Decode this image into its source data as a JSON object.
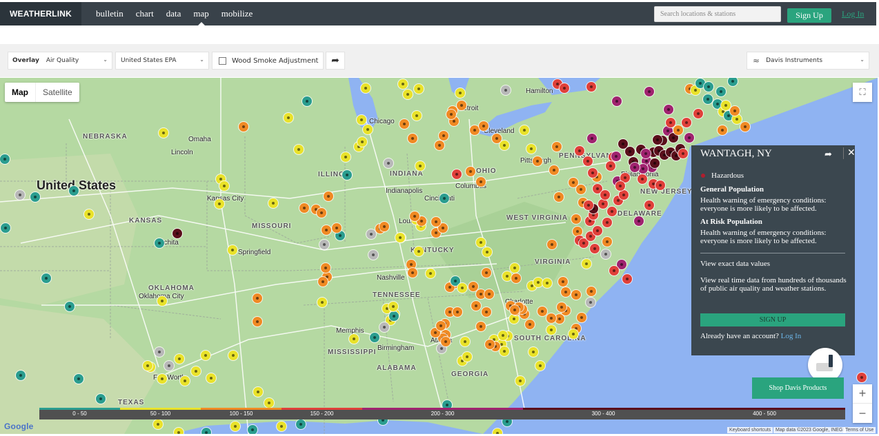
{
  "nav": {
    "brand": "WEATHERLINK",
    "links": [
      "bulletin",
      "chart",
      "data",
      "map",
      "mobilize"
    ],
    "active": "map",
    "search_placeholder": "Search locations & stations",
    "signup": "Sign Up",
    "login": "Log In"
  },
  "toolbar": {
    "overlay_label": "Overlay",
    "overlay_value": "Air Quality",
    "standard_value": "United States EPA",
    "wood_smoke": "Wood Smoke Adjustment",
    "share_icon": "share-icon",
    "network_value": "Davis Instruments"
  },
  "map": {
    "type_buttons": [
      "Map",
      "Satellite"
    ],
    "active_type": "Map",
    "zoom_in": "+",
    "zoom_out": "−",
    "labels": {
      "country": "United States",
      "states": [
        "NEBRASKA",
        "KANSAS",
        "MISSOURI",
        "OKLAHOMA",
        "TEXAS",
        "ILLINOIS",
        "INDIANA",
        "OHIO",
        "KENTUCKY",
        "TENNESSEE",
        "MISSISSIPPI",
        "ALABAMA",
        "GEORGIA",
        "SOUTH CAROLINA",
        "WEST VIRGINIA",
        "VIRGINIA",
        "PENNSYLVANIA",
        "NEW JERSEY",
        "DELAWARE"
      ],
      "cities": [
        "Omaha",
        "Lincoln",
        "Kansas City",
        "Wichita",
        "Springfield",
        "Chicago",
        "Indianapolis",
        "Columbus",
        "Cincinnati",
        "Louisville",
        "Nashville",
        "Oklahoma City",
        "Fort Worth",
        "Atlanta",
        "Charlotte",
        "Pittsburgh",
        "Philadelphia",
        "Detroit",
        "Cleveland",
        "Memphis",
        "Birmingham",
        "Hamilton"
      ]
    },
    "legend": [
      {
        "label": "0 - 50",
        "color": "#2a9d8f"
      },
      {
        "label": "50 - 100",
        "color": "#e9e22a"
      },
      {
        "label": "100 - 150",
        "color": "#f08a24"
      },
      {
        "label": "150 - 200",
        "color": "#e0403a"
      },
      {
        "label": "200 - 300",
        "color": "#a0236f"
      },
      {
        "label": "300 - 400",
        "color": "#5a0f1b"
      },
      {
        "label": "400 - 500",
        "color": "#5a0f1b"
      }
    ],
    "attribution": [
      "Keyboard shortcuts",
      "Map data ©2023 Google, INEGI",
      "Terms of Use"
    ],
    "google": "Google"
  },
  "popup": {
    "title": "WANTAGH, NY",
    "status": "Hazardous",
    "general_heading": "General Population",
    "general_text": "Health warning of emergency conditions: everyone is more likely to be affected.",
    "risk_heading": "At Risk Population",
    "risk_text": "Health warning of emergency conditions: everyone is more likely to be affected.",
    "view_exact": "View exact data values",
    "promo": "View real time data from hundreds of thousands of public air quality and weather stations.",
    "signup": "SIGN UP",
    "account_prompt": "Already have an account?",
    "login": "Log In"
  },
  "shop": "Shop Davis Products"
}
